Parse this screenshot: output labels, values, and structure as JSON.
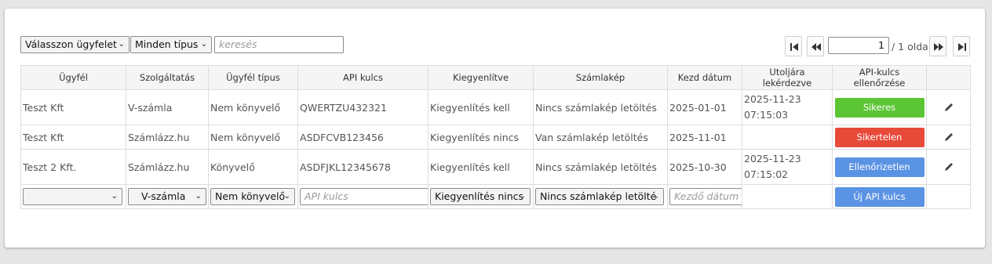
{
  "filters": {
    "client_select": "Válasszon ügyfelet",
    "type_select": "Minden típus",
    "search_placeholder": "keresés"
  },
  "pagination": {
    "current_page": "1",
    "total_label": "/ 1 oldal"
  },
  "table": {
    "headers": [
      "Ügyfél",
      "Szolgáltatás",
      "Ügyfél típus",
      "API kulcs",
      "Kiegyenlítve",
      "Számlakép",
      "Kezd dátum",
      "Utoljára lekérdezve",
      "API-kulcs ellenőrzése"
    ],
    "rows": [
      {
        "client": "Teszt Kft",
        "service": "V-számla",
        "client_type": "Nem könyvelő",
        "api_key": "QWERTZU432321",
        "settled": "Kiegyenlítés kell",
        "invoice_image": "Nincs számlakép letöltés",
        "start_date": "2025-01-01",
        "last_query_date": "2025-11-23",
        "last_query_time": "07:15:03",
        "check": "Sikeres",
        "check_color": "#5cc535"
      },
      {
        "client": "Teszt Kft",
        "service": "Számlázz.hu",
        "client_type": "Nem könyvelő",
        "api_key": "ASDFCVB123456",
        "settled": "Kiegyenlítés nincs",
        "invoice_image": "Van számlakép letöltés",
        "start_date": "2025-11-01",
        "last_query_date": "",
        "last_query_time": "",
        "check": "Sikertelen",
        "check_color": "#e84a3a"
      },
      {
        "client": "Teszt 2 Kft.",
        "service": "Számlázz.hu",
        "client_type": "Könyvelő",
        "api_key": "ASDFJKL12345678",
        "settled": "Kiegyenlítés kell",
        "invoice_image": "Nincs számlakép letöltés",
        "start_date": "2025-10-30",
        "last_query_date": "2025-11-23",
        "last_query_time": "07:15:02",
        "check": "Ellenőrizetlen",
        "check_color": "#5b93e4"
      }
    ]
  },
  "new_row": {
    "client_value": "",
    "service_value": "V-számla",
    "client_type_value": "Nem könyvelő",
    "api_key_placeholder": "API kulcs",
    "settled_value": "Kiegyenlítés nincs",
    "invoice_image_value": "Nincs számlakép letölté",
    "start_date_placeholder": "Kezdő dátum",
    "add_button": "Új API kulcs",
    "add_button_color": "#5b93e4"
  },
  "icons": {
    "edit": "pencil-icon",
    "first": "first-page-icon",
    "prev": "prev-page-icon",
    "next": "next-page-icon",
    "last": "last-page-icon",
    "dropdown": "chevron-down-icon"
  }
}
